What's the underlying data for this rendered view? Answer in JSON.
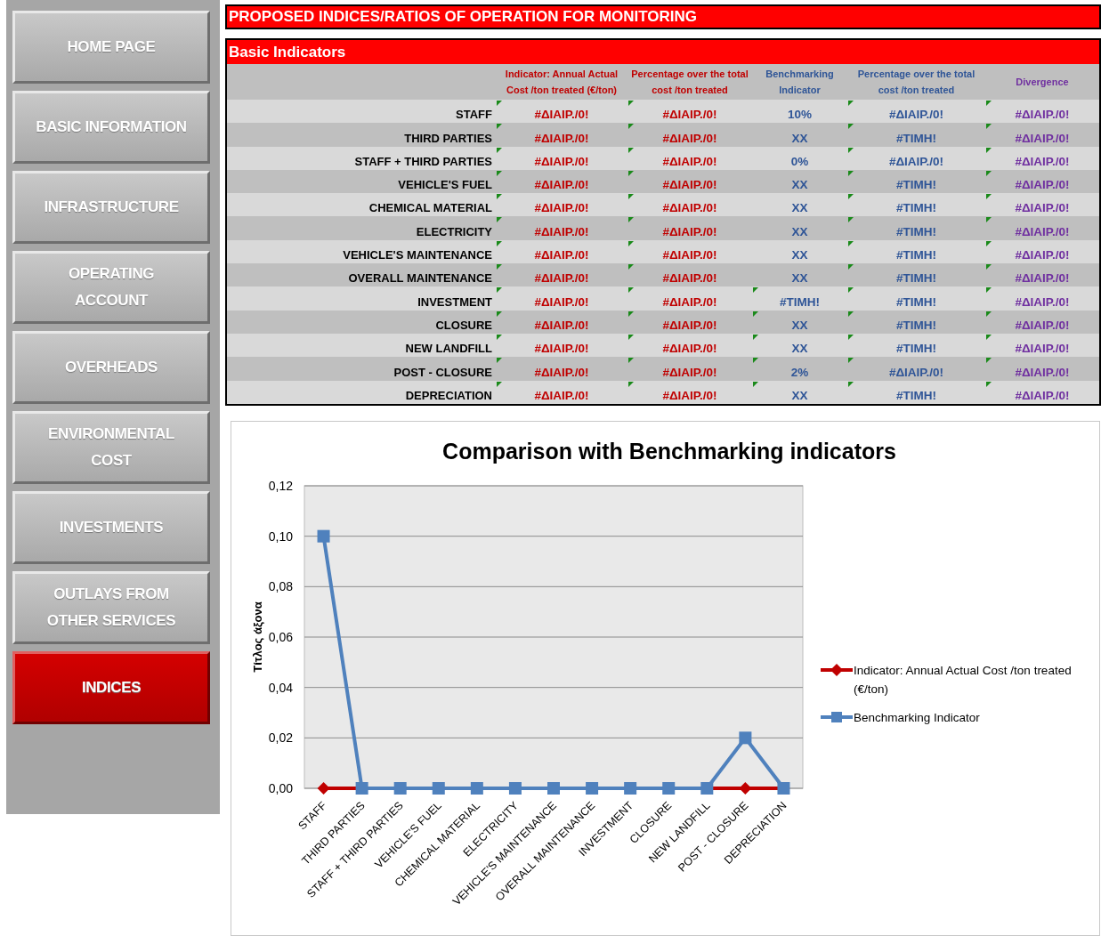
{
  "sidebar": {
    "items": [
      {
        "label": "HOME PAGE",
        "selected": false
      },
      {
        "label": "BASIC INFORMATION",
        "selected": false
      },
      {
        "label": "INFRASTRUCTURE",
        "selected": false
      },
      {
        "label": "OPERATING ACCOUNT",
        "selected": false
      },
      {
        "label": "OVERHEADS",
        "selected": false
      },
      {
        "label": "ENVIRONMENTAL COST",
        "selected": false
      },
      {
        "label": "INVESTMENTS",
        "selected": false
      },
      {
        "label": "OUTLAYS FROM OTHER SERVICES",
        "selected": false
      },
      {
        "label": "INDICES",
        "selected": true
      }
    ]
  },
  "title": "PROPOSED INDICES/RATIOS OF OPERATION FOR MONITORING",
  "table": {
    "title": "Basic Indicators",
    "columns": [
      {
        "label": "Indicator: Annual Actual Cost /ton treated (€/ton)",
        "color": "#c00000"
      },
      {
        "label": "Percentage over the total cost /ton treated",
        "color": "#c00000"
      },
      {
        "label": "Benchmarking Indicator",
        "color": "#2f5597"
      },
      {
        "label": "Percentage over the total cost /ton treated",
        "color": "#2f5597"
      },
      {
        "label": "Divergence",
        "color": "#7030a0"
      }
    ],
    "rows": [
      {
        "label": "STAFF",
        "cells": [
          {
            "text": "#ΔΙΑΙΡ./0!",
            "flagged": true
          },
          {
            "text": "#ΔΙΑΙΡ./0!",
            "flagged": true
          },
          {
            "text": "10%",
            "flagged": false
          },
          {
            "text": "#ΔΙΑΙΡ./0!",
            "flagged": true
          },
          {
            "text": "#ΔΙΑΙΡ./0!",
            "flagged": true
          }
        ]
      },
      {
        "label": "THIRD PARTIES",
        "cells": [
          {
            "text": "#ΔΙΑΙΡ./0!",
            "flagged": true
          },
          {
            "text": "#ΔΙΑΙΡ./0!",
            "flagged": true
          },
          {
            "text": "XX",
            "flagged": false
          },
          {
            "text": "#TIMH!",
            "flagged": true
          },
          {
            "text": "#ΔΙΑΙΡ./0!",
            "flagged": true
          }
        ]
      },
      {
        "label": "STAFF + THIRD PARTIES",
        "cells": [
          {
            "text": "#ΔΙΑΙΡ./0!",
            "flagged": true
          },
          {
            "text": "#ΔΙΑΙΡ./0!",
            "flagged": true
          },
          {
            "text": "0%",
            "flagged": false
          },
          {
            "text": "#ΔΙΑΙΡ./0!",
            "flagged": true
          },
          {
            "text": "#ΔΙΑΙΡ./0!",
            "flagged": true
          }
        ]
      },
      {
        "label": "VEHICLE'S FUEL",
        "cells": [
          {
            "text": "#ΔΙΑΙΡ./0!",
            "flagged": true
          },
          {
            "text": "#ΔΙΑΙΡ./0!",
            "flagged": true
          },
          {
            "text": "XX",
            "flagged": false
          },
          {
            "text": "#TIMH!",
            "flagged": true
          },
          {
            "text": "#ΔΙΑΙΡ./0!",
            "flagged": true
          }
        ]
      },
      {
        "label": "CHEMICAL MATERIAL",
        "cells": [
          {
            "text": "#ΔΙΑΙΡ./0!",
            "flagged": true
          },
          {
            "text": "#ΔΙΑΙΡ./0!",
            "flagged": true
          },
          {
            "text": "XX",
            "flagged": false
          },
          {
            "text": "#TIMH!",
            "flagged": true
          },
          {
            "text": "#ΔΙΑΙΡ./0!",
            "flagged": true
          }
        ]
      },
      {
        "label": "ELECTRICITY",
        "cells": [
          {
            "text": "#ΔΙΑΙΡ./0!",
            "flagged": true
          },
          {
            "text": "#ΔΙΑΙΡ./0!",
            "flagged": true
          },
          {
            "text": "XX",
            "flagged": false
          },
          {
            "text": "#TIMH!",
            "flagged": true
          },
          {
            "text": "#ΔΙΑΙΡ./0!",
            "flagged": true
          }
        ]
      },
      {
        "label": "VEHICLE'S MAINTENANCE",
        "cells": [
          {
            "text": "#ΔΙΑΙΡ./0!",
            "flagged": true
          },
          {
            "text": "#ΔΙΑΙΡ./0!",
            "flagged": true
          },
          {
            "text": "XX",
            "flagged": false
          },
          {
            "text": "#TIMH!",
            "flagged": true
          },
          {
            "text": "#ΔΙΑΙΡ./0!",
            "flagged": true
          }
        ]
      },
      {
        "label": "OVERALL MAINTENANCE",
        "cells": [
          {
            "text": "#ΔΙΑΙΡ./0!",
            "flagged": true
          },
          {
            "text": "#ΔΙΑΙΡ./0!",
            "flagged": true
          },
          {
            "text": "XX",
            "flagged": false
          },
          {
            "text": "#TIMH!",
            "flagged": true
          },
          {
            "text": "#ΔΙΑΙΡ./0!",
            "flagged": true
          }
        ]
      },
      {
        "label": "INVESTMENT",
        "cells": [
          {
            "text": "#ΔΙΑΙΡ./0!",
            "flagged": true
          },
          {
            "text": "#ΔΙΑΙΡ./0!",
            "flagged": true
          },
          {
            "text": "#TIMH!",
            "flagged": true
          },
          {
            "text": "#TIMH!",
            "flagged": true
          },
          {
            "text": "#ΔΙΑΙΡ./0!",
            "flagged": true
          }
        ]
      },
      {
        "label": "CLOSURE",
        "cells": [
          {
            "text": "#ΔΙΑΙΡ./0!",
            "flagged": true
          },
          {
            "text": "#ΔΙΑΙΡ./0!",
            "flagged": true
          },
          {
            "text": "XX",
            "flagged": true
          },
          {
            "text": "#TIMH!",
            "flagged": true
          },
          {
            "text": "#ΔΙΑΙΡ./0!",
            "flagged": true
          }
        ]
      },
      {
        "label": "NEW LANDFILL",
        "cells": [
          {
            "text": "#ΔΙΑΙΡ./0!",
            "flagged": true
          },
          {
            "text": "#ΔΙΑΙΡ./0!",
            "flagged": true
          },
          {
            "text": "XX",
            "flagged": true
          },
          {
            "text": "#TIMH!",
            "flagged": true
          },
          {
            "text": "#ΔΙΑΙΡ./0!",
            "flagged": true
          }
        ]
      },
      {
        "label": "POST - CLOSURE",
        "cells": [
          {
            "text": "#ΔΙΑΙΡ./0!",
            "flagged": true
          },
          {
            "text": "#ΔΙΑΙΡ./0!",
            "flagged": true
          },
          {
            "text": "2%",
            "flagged": true
          },
          {
            "text": "#ΔΙΑΙΡ./0!",
            "flagged": true
          },
          {
            "text": "#ΔΙΑΙΡ./0!",
            "flagged": true
          }
        ]
      },
      {
        "label": "DEPRECIATION",
        "cells": [
          {
            "text": "#ΔΙΑΙΡ./0!",
            "flagged": true
          },
          {
            "text": "#ΔΙΑΙΡ./0!",
            "flagged": true
          },
          {
            "text": "XX",
            "flagged": true
          },
          {
            "text": "#TIMH!",
            "flagged": true
          },
          {
            "text": "#ΔΙΑΙΡ./0!",
            "flagged": true
          }
        ]
      }
    ]
  },
  "chart": {
    "chart_data": {
      "type": "line",
      "title": "Comparison with Benchmarking indicators",
      "ylabel": "Τίτλος άξονα",
      "categories": [
        "STAFF",
        "THIRD PARTIES",
        "STAFF + THIRD PARTIES",
        "VEHICLE'S FUEL",
        "CHEMICAL MATERIAL",
        "ELECTRICITY",
        "VEHICLE'S MAINTENANCE",
        "OVERALL MAINTENANCE",
        "INVESTMENT",
        "CLOSURE",
        "NEW LANDFILL",
        "POST - CLOSURE",
        "DEPRECIATION"
      ],
      "series": [
        {
          "name": "Indicator: Annual Actual Cost /ton treated (€/ton)",
          "color": "#c00000",
          "marker": "diamond",
          "values": [
            0,
            0,
            null,
            null,
            null,
            null,
            null,
            null,
            null,
            null,
            0,
            0,
            0
          ]
        },
        {
          "name": "Benchmarking Indicator",
          "color": "#4f81bd",
          "marker": "square",
          "values": [
            0.1,
            0,
            0,
            0,
            0,
            0,
            0,
            0,
            0,
            0,
            0,
            0.02,
            0
          ]
        }
      ],
      "grid": true,
      "legend": true,
      "ylim": [
        0,
        0.12
      ],
      "yticks": [
        {
          "value": 0,
          "label": "0,00"
        },
        {
          "value": 0.02,
          "label": "0,02"
        },
        {
          "value": 0.04,
          "label": "0,04"
        },
        {
          "value": 0.06,
          "label": "0,06"
        },
        {
          "value": 0.08,
          "label": "0,08"
        },
        {
          "value": 0.1,
          "label": "0,10"
        },
        {
          "value": 0.12,
          "label": "0,12"
        }
      ]
    }
  }
}
